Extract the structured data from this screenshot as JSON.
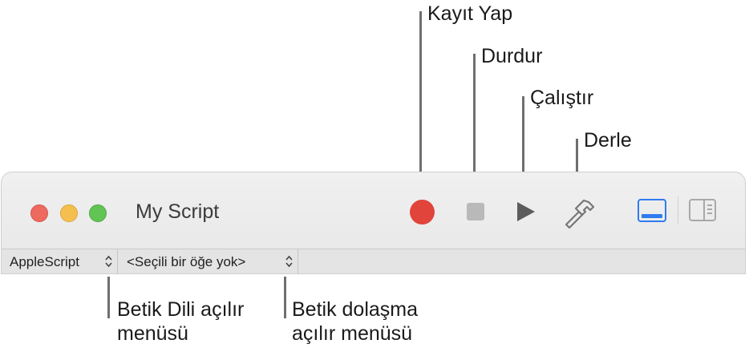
{
  "callouts": {
    "record": "Kayıt Yap",
    "stop": "Durdur",
    "run": "Çalıştır",
    "compile": "Derle",
    "language_popup": "Betik Dili açılır menüsü",
    "navigation_popup": "Betik dolaşma açılır menüsü"
  },
  "window": {
    "title": "My Script"
  },
  "navbar": {
    "language": "AppleScript",
    "navigation": "<Seçili bir öğe yok>"
  },
  "colors": {
    "record": "#e0443a",
    "accent": "#2f7bf0",
    "close": "#ec6a5f",
    "minimize": "#f4bf4f",
    "zoom": "#61c454"
  }
}
